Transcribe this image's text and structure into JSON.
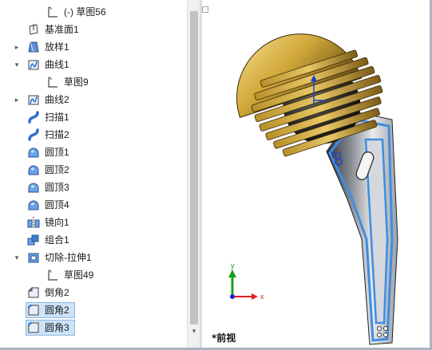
{
  "feature_tree": {
    "items": [
      {
        "label": "(-) 草图56",
        "icon": "sketch-icon",
        "expander": "",
        "indent": 1,
        "selected": false
      },
      {
        "label": "基准面1",
        "icon": "plane-icon",
        "expander": "",
        "indent": 0,
        "selected": false
      },
      {
        "label": "放样1",
        "icon": "loft-icon",
        "expander": "▸",
        "indent": 0,
        "selected": false
      },
      {
        "label": "曲线1",
        "icon": "curve-icon",
        "expander": "▾",
        "indent": 0,
        "selected": false
      },
      {
        "label": "草图9",
        "icon": "sketch-icon",
        "expander": "",
        "indent": 1,
        "selected": false
      },
      {
        "label": "曲线2",
        "icon": "curve-icon",
        "expander": "▸",
        "indent": 0,
        "selected": false
      },
      {
        "label": "扫描1",
        "icon": "sweep-icon",
        "expander": "",
        "indent": 0,
        "selected": false
      },
      {
        "label": "扫描2",
        "icon": "sweep-icon",
        "expander": "",
        "indent": 0,
        "selected": false
      },
      {
        "label": "圆顶1",
        "icon": "dome-icon",
        "expander": "",
        "indent": 0,
        "selected": false
      },
      {
        "label": "圆顶2",
        "icon": "dome-icon",
        "expander": "",
        "indent": 0,
        "selected": false
      },
      {
        "label": "圆顶3",
        "icon": "dome-icon",
        "expander": "",
        "indent": 0,
        "selected": false
      },
      {
        "label": "圆顶4",
        "icon": "dome-icon",
        "expander": "",
        "indent": 0,
        "selected": false
      },
      {
        "label": "镜向1",
        "icon": "mirror-icon",
        "expander": "",
        "indent": 0,
        "selected": false
      },
      {
        "label": "组合1",
        "icon": "combine-icon",
        "expander": "",
        "indent": 0,
        "selected": false
      },
      {
        "label": "切除-拉伸1",
        "icon": "extrude-cut-icon",
        "expander": "▾",
        "indent": 0,
        "selected": false
      },
      {
        "label": "草图49",
        "icon": "sketch-icon",
        "expander": "",
        "indent": 1,
        "selected": false
      },
      {
        "label": "倒角2",
        "icon": "chamfer-icon",
        "expander": "",
        "indent": 0,
        "selected": false
      },
      {
        "label": "圆角2",
        "icon": "fillet-icon",
        "expander": "",
        "indent": 0,
        "selected": true
      },
      {
        "label": "圆角3",
        "icon": "fillet-icon",
        "expander": "",
        "indent": 0,
        "selected": true
      }
    ]
  },
  "scrollbar": {
    "down_arrow": "▾"
  },
  "viewport": {
    "view_name": "*前视",
    "triad": {
      "x": "x",
      "y": "y"
    },
    "sketch_origin_label": "R1"
  },
  "colors": {
    "selection": "#cde3f7",
    "dome_gold": "#d2a93a",
    "ball_dark": "#2a2a2a",
    "stem_grey": "#5d6168",
    "stem_edge": "#3f8de0",
    "axis_x": "#e02020",
    "axis_y": "#1aa11a",
    "axis_z": "#2020d0"
  }
}
